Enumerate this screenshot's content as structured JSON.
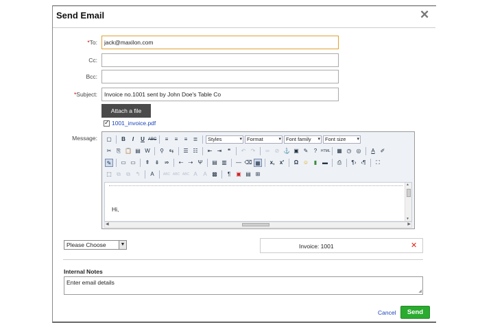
{
  "dialog": {
    "title": "Send Email",
    "close_glyph": "✕"
  },
  "fields": {
    "to": {
      "label": "To:",
      "value": "jack@maxilon.com"
    },
    "cc": {
      "label": "Cc:",
      "value": ""
    },
    "bcc": {
      "label": "Bcc:",
      "value": ""
    },
    "subject": {
      "label": "Subject:",
      "value": "Invoice no.1001 sent by John Doe's Table Co"
    }
  },
  "attachment": {
    "button_label": "Attach a file",
    "file_name": "1001_invoice.pdf",
    "checked": true
  },
  "message": {
    "label": "Message:",
    "toolbar_selects": {
      "styles": "Styles",
      "format": "Format",
      "font_family": "Font family",
      "font_size": "Font size"
    },
    "body_text": "Hi,"
  },
  "choose": {
    "selected": "Please Choose"
  },
  "invoice": {
    "label": "Invoice:",
    "number": "1001",
    "remove_glyph": "✕"
  },
  "notes": {
    "label": "Internal Notes",
    "value": "Enter email details"
  },
  "actions": {
    "cancel": "Cancel",
    "send": "Send"
  },
  "colors": {
    "send_green": "#2bab2f",
    "link_blue": "#1a44b8",
    "required_red": "#cc0000",
    "remove_red": "#dd2211"
  }
}
